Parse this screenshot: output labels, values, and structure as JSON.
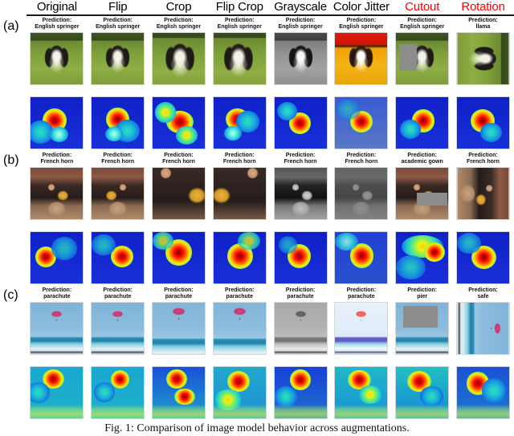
{
  "figure": {
    "caption": "Fig. 1: Comparison of image model behavior across augmentations.",
    "panels": [
      "(a)",
      "(b)",
      "(c)"
    ],
    "prediction_prefix": "Prediction:",
    "accent_warning_color": "#ff0000"
  },
  "columns": [
    {
      "label": "Original",
      "highlight": false
    },
    {
      "label": "Flip",
      "highlight": false
    },
    {
      "label": "Crop",
      "highlight": false
    },
    {
      "label": "Flip Crop",
      "highlight": false
    },
    {
      "label": "Grayscale",
      "highlight": false
    },
    {
      "label": "Color Jitter",
      "highlight": false
    },
    {
      "label": "Cutout",
      "highlight": true
    },
    {
      "label": "Rotation",
      "highlight": true
    }
  ],
  "rows": [
    {
      "panel": "(a)",
      "subject": "english-springer",
      "predictions": [
        "Prediction:\nEnglish springer",
        "Prediction:\nEnglish springer",
        "Prediction:\nEnglish springer",
        "Prediction:\nEnglish springer",
        "Prediction:\nEnglish springer",
        "Prediction:\nEnglish springer",
        "Prediction:\nEnglish springer",
        "Prediction:\nllama"
      ],
      "predicted_classes": [
        "English springer",
        "English springer",
        "English springer",
        "English springer",
        "English springer",
        "English springer",
        "English springer",
        "llama"
      ]
    },
    {
      "panel": "(b)",
      "subject": "french-horn",
      "predictions": [
        "Prediction:\nFrench horn",
        "Prediction:\nFrench horn",
        "Prediction:\nFrench horn",
        "Prediction:\nFrench horn",
        "Prediction:\nFrench horn",
        "Prediction:\nFrench horn",
        "Prediction:\nacademic gown",
        "Prediction:\nFrench horn"
      ],
      "predicted_classes": [
        "French horn",
        "French horn",
        "French horn",
        "French horn",
        "French horn",
        "French horn",
        "academic gown",
        "French horn"
      ]
    },
    {
      "panel": "(c)",
      "subject": "parachute",
      "predictions": [
        "Prediction:\nparachute",
        "Prediction:\nparachute",
        "Prediction:\nparachute",
        "Prediction:\nparachute",
        "Prediction:\nparachute",
        "Prediction:\nparachute",
        "Prediction:\npier",
        "Prediction:\nsafe"
      ],
      "predicted_classes": [
        "parachute",
        "parachute",
        "parachute",
        "parachute",
        "parachute",
        "parachute",
        "pier",
        "safe"
      ]
    }
  ]
}
